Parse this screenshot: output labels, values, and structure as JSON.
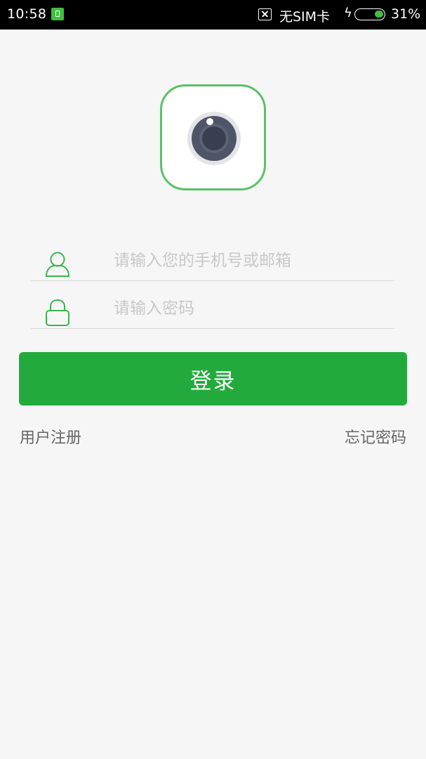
{
  "status_bar": {
    "time": "10:58",
    "sim_status": "无SIM卡",
    "charging_symbol": "ϟ",
    "battery_percent": "31%",
    "battery_level": 0.31,
    "accent_color": "#3fbf3f"
  },
  "logo": {
    "icon": "camera-icon",
    "border_color": "#5cc068"
  },
  "login_form": {
    "account_placeholder": "请输入您的手机号或邮箱",
    "password_placeholder": "请输入密码",
    "account_icon": "user-icon",
    "password_icon": "lock-icon",
    "login_label": "登录",
    "button_color": "#22aa3c"
  },
  "links": {
    "register": "用户注册",
    "forgot_password": "忘记密码"
  }
}
